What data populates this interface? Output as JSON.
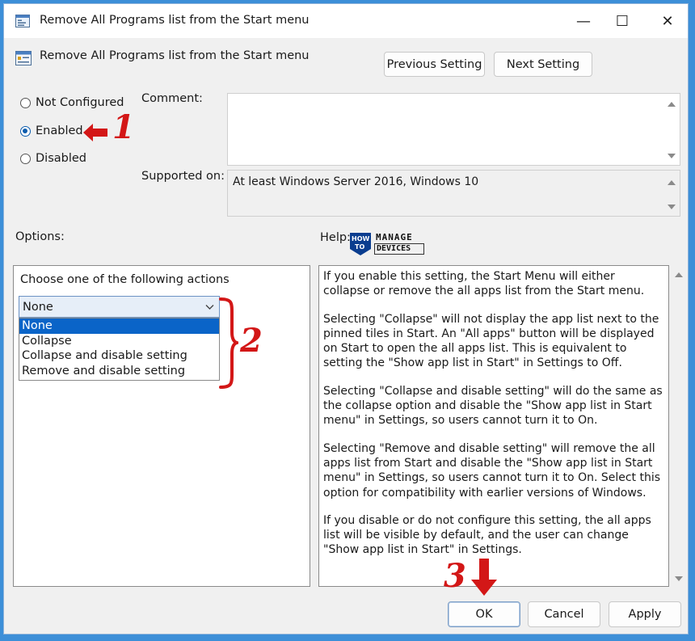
{
  "window": {
    "title": "Remove All Programs list from the Start menu",
    "minimize_glyph": "—",
    "maximize_glyph": "☐",
    "close_glyph": "✕"
  },
  "header": {
    "policy_name": "Remove All Programs list from the Start menu",
    "previous_label": "Previous Setting",
    "next_label": "Next Setting"
  },
  "state": {
    "options": [
      {
        "label": "Not Configured",
        "checked": false
      },
      {
        "label": "Enabled",
        "checked": true
      },
      {
        "label": "Disabled",
        "checked": false
      }
    ]
  },
  "comment": {
    "label": "Comment:",
    "value": ""
  },
  "supported": {
    "label": "Supported on:",
    "value": "At least Windows Server 2016, Windows 10"
  },
  "options_section": {
    "label": "Options:",
    "prompt": "Choose one of the following actions",
    "selected": "None",
    "dropdown_items": [
      "None",
      "Collapse",
      "Collapse and disable setting",
      "Remove and disable setting"
    ]
  },
  "help_section": {
    "label": "Help:",
    "logo": {
      "how": "HOW",
      "to": "TO",
      "manage": "MANAGE",
      "devices": "DEVICES"
    },
    "paragraphs": [
      "If you enable this setting, the Start Menu will either collapse or remove the all apps list from the Start menu.",
      "Selecting \"Collapse\" will not display the app list next to the pinned tiles in Start. An \"All apps\" button will be displayed on Start to open the all apps list. This is equivalent to setting the \"Show app list in Start\" in Settings to Off.",
      "Selecting \"Collapse and disable setting\" will do the same as the collapse option and disable the \"Show app list in Start menu\" in Settings, so users cannot turn it to On.",
      "Selecting \"Remove and disable setting\" will remove the all apps list from Start and disable the \"Show app list in Start menu\" in Settings, so users cannot turn it to On. Select this option for compatibility with earlier versions of Windows.",
      "If you disable or do not configure this setting, the all apps list will be visible by default, and the user can change \"Show app list in Start\" in Settings."
    ]
  },
  "footer": {
    "ok_label": "OK",
    "cancel_label": "Cancel",
    "apply_label": "Apply"
  },
  "annotations": {
    "step1": "1",
    "step2": "2",
    "step3": "3",
    "color": "#d31717"
  }
}
